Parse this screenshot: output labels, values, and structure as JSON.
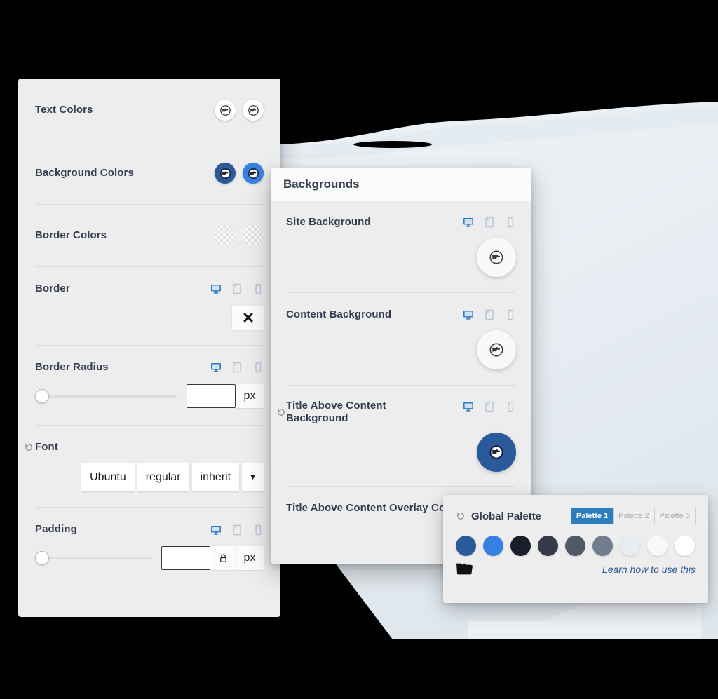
{
  "left_panel": {
    "rows": [
      {
        "label": "Text Colors",
        "type": "swatches",
        "swatches": [
          "white-globe",
          "white-globe"
        ]
      },
      {
        "label": "Background Colors",
        "type": "swatches",
        "swatches": [
          "navy-globe",
          "blue-globe"
        ]
      },
      {
        "label": "Border Colors",
        "type": "swatches",
        "swatches": [
          "transparent",
          "transparent"
        ]
      },
      {
        "label": "Border",
        "type": "devices-x"
      },
      {
        "label": "Border Radius",
        "type": "slider",
        "value": "",
        "unit": "px"
      },
      {
        "label": "Font",
        "type": "font"
      },
      {
        "label": "Padding",
        "type": "slider-lock",
        "value": "",
        "unit": "px"
      }
    ],
    "font_buttons": [
      "Ubuntu",
      "regular",
      "inherit"
    ],
    "font_caret": "▼",
    "border_radius_unit": "px",
    "padding_unit": "px",
    "border_radius_value": "",
    "padding_value": "",
    "close_glyph": "✕"
  },
  "bg_panel": {
    "title": "Backgrounds",
    "rows": [
      {
        "label": "Site Background",
        "reset": false,
        "swatch": "white-globe"
      },
      {
        "label": "Content Background",
        "reset": false,
        "swatch": "white-globe"
      },
      {
        "label": "Title Above Content Background",
        "reset": true,
        "swatch": "navy-globe"
      },
      {
        "label": "Title Above Content Overlay Color",
        "reset": false,
        "swatch": "none"
      }
    ]
  },
  "palette_panel": {
    "title": "Global Palette",
    "tabs": [
      {
        "label": "Palette 1",
        "active": true
      },
      {
        "label": "Palette 2",
        "active": false
      },
      {
        "label": "Palette 3",
        "active": false
      }
    ],
    "colors": [
      "#2b5a9b",
      "#3780e3",
      "#1a1e2b",
      "#353b49",
      "#515966",
      "#717c8c",
      "#e8ecf1",
      "#f7f8fa",
      "#ffffff"
    ],
    "link": "Learn how to use this",
    "folder_icon": "folder-icon"
  },
  "theme": {
    "panel_bg": "#ededed",
    "title_bar_bg": "#fbfbfb",
    "text": "#343d50",
    "accent_navy": "#2b5a9b",
    "accent_blue": "#3780e3",
    "tab_active": "#2d7dbe",
    "decor_blue": "#e8eef3"
  }
}
